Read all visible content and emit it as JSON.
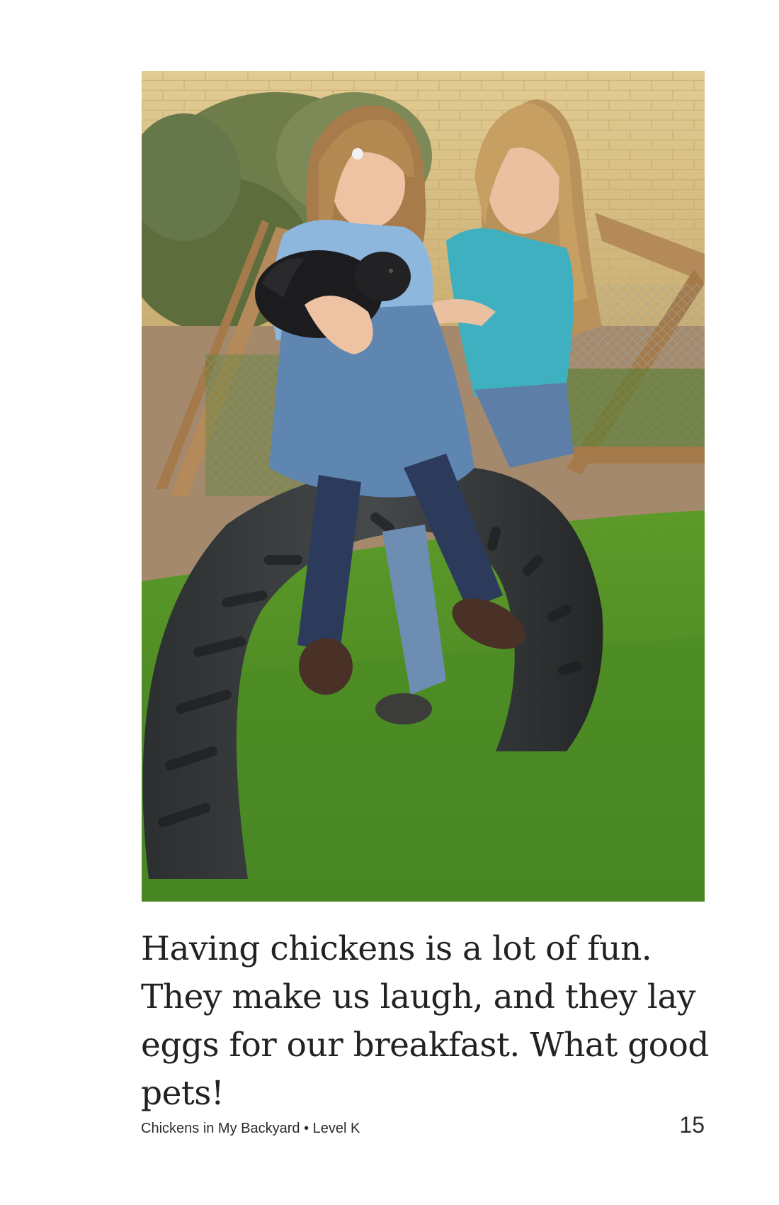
{
  "page": {
    "body_text": "Having chickens is a lot of fun. They make us laugh, and they lay eggs for our breakfast. What good pets!",
    "footer_title": "Chickens in My Backyard • Level K",
    "page_number": "15"
  },
  "photo": {
    "icon": "backyard-photo-illustration"
  }
}
